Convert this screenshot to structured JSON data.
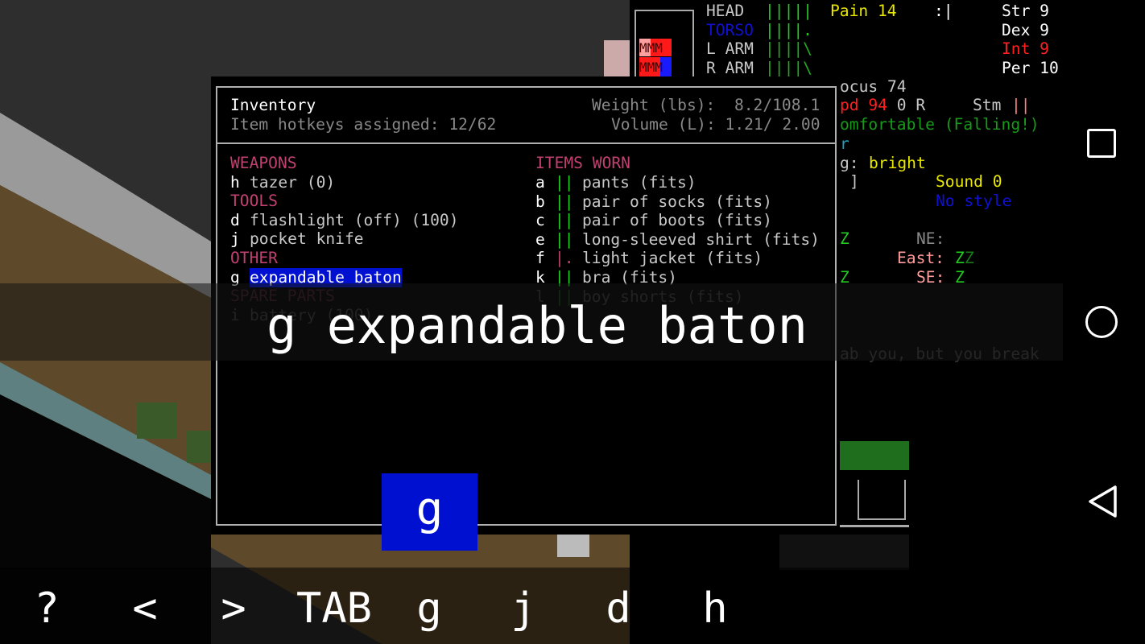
{
  "colors": {
    "highlight": "#0010d0",
    "category": "#c04070",
    "green": "#22cc22",
    "yellow": "#e8e800",
    "red": "#ff2020",
    "blue": "#1010d0",
    "pink": "#ff9c9c",
    "gray": "#c8c8c8",
    "darkgray": "#404040"
  },
  "inventory": {
    "title": "Inventory",
    "hotkeys": "Item hotkeys assigned: 12/62",
    "weight": "Weight (lbs):  8.2/108.1",
    "volume": "Volume (L): 1.21/ 2.00",
    "left": [
      {
        "type": "cat",
        "text": "WEAPONS"
      },
      {
        "type": "item",
        "key": "h",
        "text": "tazer (0)"
      },
      {
        "type": "cat",
        "text": "TOOLS"
      },
      {
        "type": "item",
        "key": "d",
        "text": "flashlight (off) (100)"
      },
      {
        "type": "item",
        "key": "j",
        "text": "pocket knife"
      },
      {
        "type": "cat",
        "text": "OTHER"
      },
      {
        "type": "item",
        "key": "g",
        "text": "expandable baton",
        "selected": true
      },
      {
        "type": "cat",
        "text": "SPARE PARTS",
        "dim": true
      },
      {
        "type": "item",
        "key": "i",
        "text": "battery (100)",
        "dim": true
      }
    ],
    "right_header": "ITEMS WORN",
    "worn": [
      {
        "key": "a",
        "bars": "||",
        "bar_color": "#22cc22",
        "text": "pants (fits)"
      },
      {
        "key": "b",
        "bars": "||",
        "bar_color": "#22cc22",
        "text": "pair of socks (fits)"
      },
      {
        "key": "c",
        "bars": "||",
        "bar_color": "#22cc22",
        "text": "pair of boots (fits)"
      },
      {
        "key": "e",
        "bars": "||",
        "bar_color": "#22cc22",
        "text": "long-sleeved shirt (fits)"
      },
      {
        "key": "f",
        "bars": "|.",
        "bar_color": "#c04070",
        "text": "light jacket (fits)"
      },
      {
        "key": "k",
        "bars": "||",
        "bar_color": "#22cc22",
        "text": "bra (fits)"
      },
      {
        "key": "l",
        "bars": "||",
        "bar_color": "#22cc22",
        "text": "boy shorts (fits)",
        "dim": true
      }
    ]
  },
  "overlay": {
    "selected_text": "g expandable baton",
    "pressed_key": "g"
  },
  "shortcuts": [
    "?",
    "<",
    ">",
    "TAB",
    "g",
    "j",
    "d",
    "h"
  ],
  "sidebar": {
    "body": [
      {
        "part": "HEAD",
        "part_color": "#c8c8c8",
        "bars": "|||||",
        "bar_color": "#22cc22"
      },
      {
        "part": "TORSO",
        "part_color": "#1010d0",
        "bars": "||||.",
        "bar_color": "#22cc22"
      },
      {
        "part": "L ARM",
        "part_color": "#c8c8c8",
        "bars": "||||\\",
        "bar_color": "#22aa22"
      },
      {
        "part": "R ARM",
        "part_color": "#c8c8c8",
        "bars": "||||\\",
        "bar_color": "#22aa22"
      }
    ],
    "pain": "Pain 14",
    "face": ":|",
    "stats": [
      {
        "text": "Str 9",
        "color": "#ffffff"
      },
      {
        "text": "Dex 9",
        "color": "#ffffff"
      },
      {
        "text": "Int 9",
        "color": "#ff2020"
      },
      {
        "text": "Per 10",
        "color": "#ffffff"
      }
    ],
    "focus": "ocus 74",
    "speed": "pd 94",
    "move": " 0 R",
    "stamina_label": "Stm",
    "stamina_bars": "||",
    "temperature": "omfortable (Falling!)",
    "r_line": "r",
    "light_label": "g: ",
    "light_value": "bright",
    "bracket": "]",
    "sound": "Sound 0",
    "style": "No style",
    "z1": "Z",
    "ne": "NE:",
    "east": "East:",
    "east_z1": "Z",
    "east_z2": "Z",
    "z2": "Z",
    "se": "SE:",
    "se_z": "Z",
    "message": "ab you, but you break",
    "body_glyphs": "MMM"
  }
}
